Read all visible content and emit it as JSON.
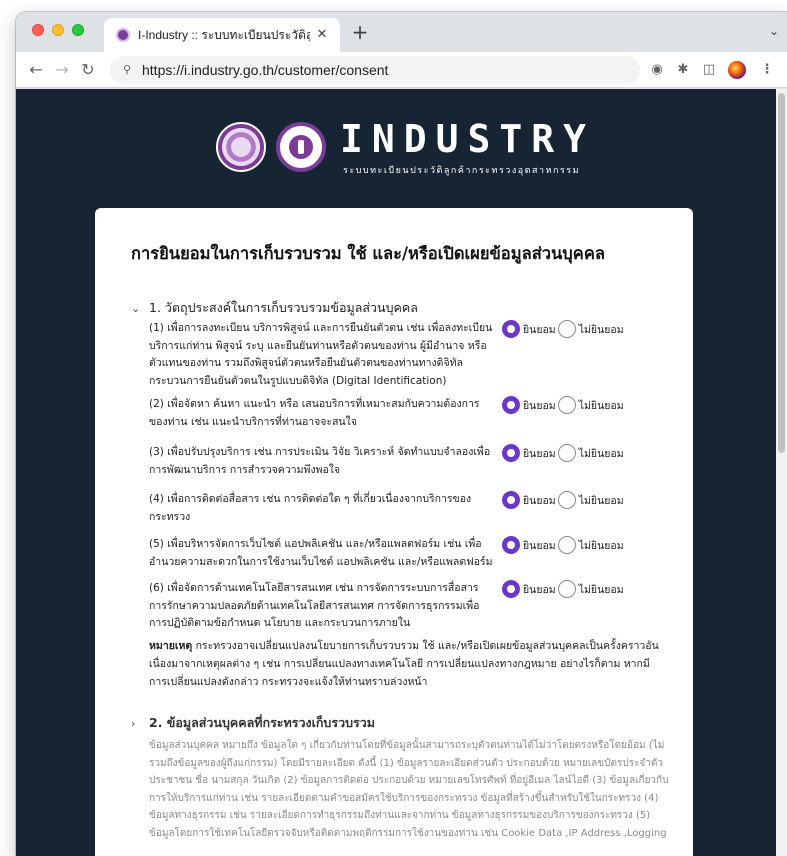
{
  "browser": {
    "tab_title": "I-Industry :: ระบบทะเบียนประวัติลูกค้า",
    "tab_close": "✕",
    "new_tab": "+",
    "url": "https://i.industry.go.th/customer/consent"
  },
  "brand": {
    "wordmark": "INDUSTRY",
    "subtitle": "ระบบทะเบียนประวัติลูกค้ากระทรวงอุตสาหกรรม"
  },
  "page": {
    "title": "การยินยอมในการเก็บรวบรวม ใช้ และ/หรือเปิดเผยข้อมูลส่วนบุคคล",
    "accept_label": "ยินยอม",
    "decline_label": "ไม่ยินยอม",
    "section1": {
      "title": "1. วัตถุประสงค์ในการเก็บรวบรวมข้อมูลส่วนบุคคล",
      "items": [
        {
          "text": "(1) เพื่อการลงทะเบียน บริการพิสูจน์ และการยืนยันตัวตน เช่น เพื่อลงทะเบียนบริการแก่ท่าน พิสูจน์ ระบุ และยืนยันท่านหรือตัวตนของท่าน ผู้มีอำนาจ หรือตัวแทนของท่าน รวมถึงพิสูจน์ตัวตนหรือยืนยันตัวตนของท่านทางดิจิทัล กระบวนการยืนยันตัวตนในรูปแบบดิจิทัล (Digital Identification)",
          "selected": "accept"
        },
        {
          "text": "(2) เพื่อจัดหา ค้นหา แนะนำ หรือ เสนอบริการที่เหมาะสมกับความต้องการของท่าน เช่น แนะนำบริการที่ท่านอาจจะสนใจ",
          "selected": "accept"
        },
        {
          "text": "(3) เพื่อปรับปรุงบริการ เช่น การประเมิน วิจัย วิเคราะห์ จัดทำแบบจำลองเพื่อการพัฒนาบริการ การสำรวจความพึงพอใจ",
          "selected": "accept"
        },
        {
          "text": "(4) เพื่อการติดต่อสื่อสาร เช่น การติดต่อใด ๆ ที่เกี่ยวเนื่องจากบริการของกระทรวง",
          "selected": "accept"
        },
        {
          "text": "(5) เพื่อบริหารจัดการเว็บไซต์ แอปพลิเคชัน และ/หรือแพลตฟอร์ม เช่น เพื่ออำนวยความสะดวกในการใช้งานเว็บไซต์ แอปพลิเคชัน และ/หรือแพลตฟอร์ม",
          "selected": "accept"
        },
        {
          "text": "(6) เพื่อจัดการด้านเทคโนโลยีสารสนเทศ เช่น การจัดการระบบการสื่อสาร การรักษาความปลอดภัยด้านเทคโนโลยีสารสนเทศ การจัดการธุรกรรมเพื่อการปฏิบัติตามข้อกำหนด นโยบาย และกระบวนการภายใน",
          "selected": "accept"
        }
      ]
    },
    "note_label": "หมายเหตุ",
    "note_text": "กระทรวงอาจเปลี่ยนแปลงนโยบายการเก็บรวบรวม ใช้ และ/หรือเปิดเผยข้อมูลส่วนบุคคลเป็นครั้งคราวอันเนื่องมาจากเหตุผลต่าง ๆ เช่น การเปลี่ยนแปลงทางเทคโนโลยี การเปลี่ยนแปลงทางกฎหมาย อย่างไรก็ตาม หากมีการเปลี่ยนแปลงดังกล่าว กระทรวงจะแจ้งให้ท่านทราบล่วงหน้า",
    "section2": {
      "title": "2. ข้อมูลส่วนบุคคลที่กระทรวงเก็บรวบรวม",
      "body": "ข้อมูลส่วนบุคคล หมายถึง ข้อมูลใด ๆ เกี่ยวกับท่านโดยที่ข้อมูลนั้นสามารถระบุตัวตนท่านได้ไม่ว่าโดยตรงหรือโดยอ้อม (ไม่รวมถึงข้อมูลของผู้ถึงแก่กรรม) โดยมีรายละเอียด ดังนี้ (1) ข้อมูลรายละเอียดส่วนตัว ประกอบด้วย หมายเลขบัตรประจำตัวประชาชน ชื่อ นามสกุล วันเกิด (2) ข้อมูลการติดต่อ ประกอบด้วย หมายเลขโทรศัพท์ ที่อยู่อีเมล ไลน์ไอดี (3) ข้อมูลเกี่ยวกับการให้บริการแก่ท่าน เช่น รายละเอียดตามคำขอสมัครใช้บริการของกระทรวง ข้อมูลที่สร้างขึ้นสำหรับใช้ในกระทรวง (4) ข้อมูลทางธุรกรรม เช่น รายละเอียดการทำธุรกรรมถึงท่านและจากท่าน ข้อมูลทางธุรกรรมของบริการของกระทรวง (5) ข้อมูลโดยการใช้เทคโนโลยีตรวจจับหรือติดตามพฤติกรรมการใช้งานของท่าน เช่น Cookie Data ,IP Address ,Logging"
    }
  }
}
